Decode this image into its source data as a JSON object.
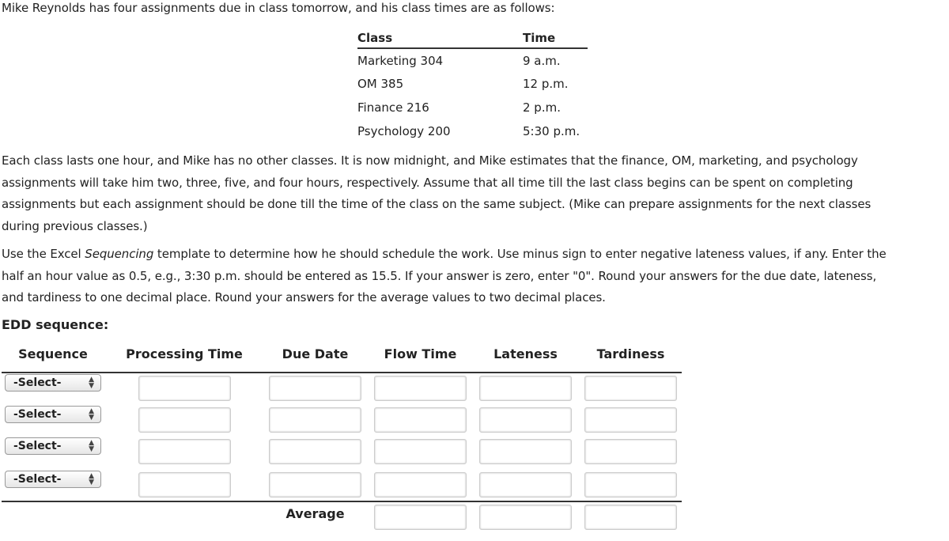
{
  "intro": "Mike Reynolds has four assignments due in class tomorrow, and his class times are as follows:",
  "class_table": {
    "headers": [
      "Class",
      "Time"
    ],
    "rows": [
      [
        "Marketing 304",
        "9 a.m."
      ],
      [
        "OM 385",
        "12 p.m."
      ],
      [
        "Finance 216",
        "2 p.m."
      ],
      [
        "Psychology 200",
        "5:30 p.m."
      ]
    ]
  },
  "para1": [
    "Each class lasts one hour, and Mike has no other classes. It is now midnight, and Mike estimates that the finance, OM, marketing, and psychology",
    "assignments will take him two, three, five, and four hours, respectively. Assume that all time till the last class begins can be spent on completing",
    "assignments but each assignment should be done till the time of the class on the same subject. (Mike can prepare assignments for the next classes",
    "during previous classes.)"
  ],
  "para2": {
    "l1a": "Use the Excel ",
    "l1i": "Sequencing",
    "l1b": " template to determine how he should schedule the work. Use minus sign to enter negative lateness values, if any. Enter the",
    "l2": "half an hour value as 0.5, e.g., 3:30 p.m. should be entered as 15.5. If your answer is zero, enter \"0\". Round your answers for the due date, lateness,",
    "l3": "and tardiness to one decimal place. Round your answers for the average values to two decimal places."
  },
  "edd_label": "EDD sequence:",
  "table": {
    "headers": [
      "Sequence",
      "Processing Time",
      "Due Date",
      "Flow Time",
      "Lateness",
      "Tardiness"
    ],
    "select_value": "-Select-",
    "average_label": "Average"
  }
}
